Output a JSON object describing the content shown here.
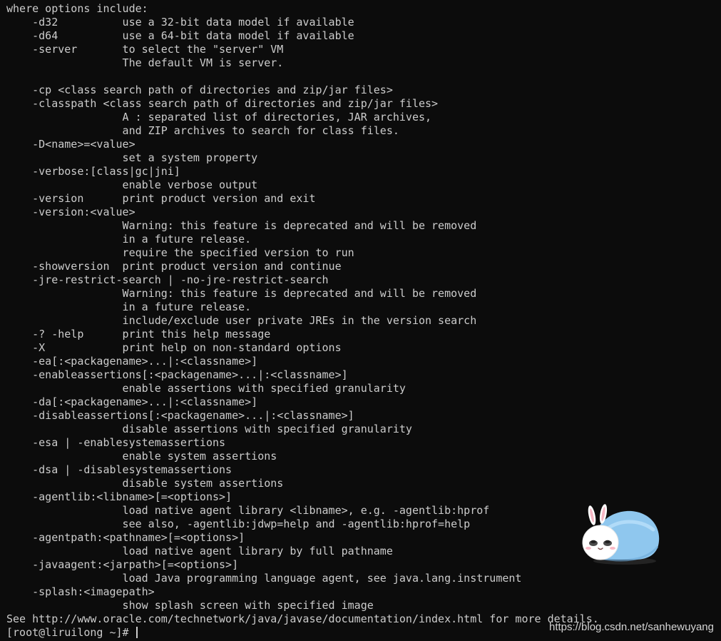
{
  "terminal": {
    "lines": [
      "where options include:",
      "    -d32          use a 32-bit data model if available",
      "    -d64          use a 64-bit data model if available",
      "    -server       to select the \"server\" VM",
      "                  The default VM is server.",
      "",
      "    -cp <class search path of directories and zip/jar files>",
      "    -classpath <class search path of directories and zip/jar files>",
      "                  A : separated list of directories, JAR archives,",
      "                  and ZIP archives to search for class files.",
      "    -D<name>=<value>",
      "                  set a system property",
      "    -verbose:[class|gc|jni]",
      "                  enable verbose output",
      "    -version      print product version and exit",
      "    -version:<value>",
      "                  Warning: this feature is deprecated and will be removed",
      "                  in a future release.",
      "                  require the specified version to run",
      "    -showversion  print product version and continue",
      "    -jre-restrict-search | -no-jre-restrict-search",
      "                  Warning: this feature is deprecated and will be removed",
      "                  in a future release.",
      "                  include/exclude user private JREs in the version search",
      "    -? -help      print this help message",
      "    -X            print help on non-standard options",
      "    -ea[:<packagename>...|:<classname>]",
      "    -enableassertions[:<packagename>...|:<classname>]",
      "                  enable assertions with specified granularity",
      "    -da[:<packagename>...|:<classname>]",
      "    -disableassertions[:<packagename>...|:<classname>]",
      "                  disable assertions with specified granularity",
      "    -esa | -enablesystemassertions",
      "                  enable system assertions",
      "    -dsa | -disablesystemassertions",
      "                  disable system assertions",
      "    -agentlib:<libname>[=<options>]",
      "                  load native agent library <libname>, e.g. -agentlib:hprof",
      "                  see also, -agentlib:jdwp=help and -agentlib:hprof=help",
      "    -agentpath:<pathname>[=<options>]",
      "                  load native agent library by full pathname",
      "    -javaagent:<jarpath>[=<options>]",
      "                  load Java programming language agent, see java.lang.instrument",
      "    -splash:<imagepath>",
      "                  show splash screen with specified image",
      "See http://www.oracle.com/technetwork/java/javase/documentation/index.html for more details."
    ],
    "prompt": "[root@liruilong ~]# "
  },
  "watermark": {
    "text": "https://blog.csdn.net/sanhewuyang"
  },
  "colors": {
    "background": "#0c0c0c",
    "text": "#cccccc",
    "watermark": "#ffffff"
  },
  "sticker": {
    "icon": "bunny-sticker-icon"
  }
}
